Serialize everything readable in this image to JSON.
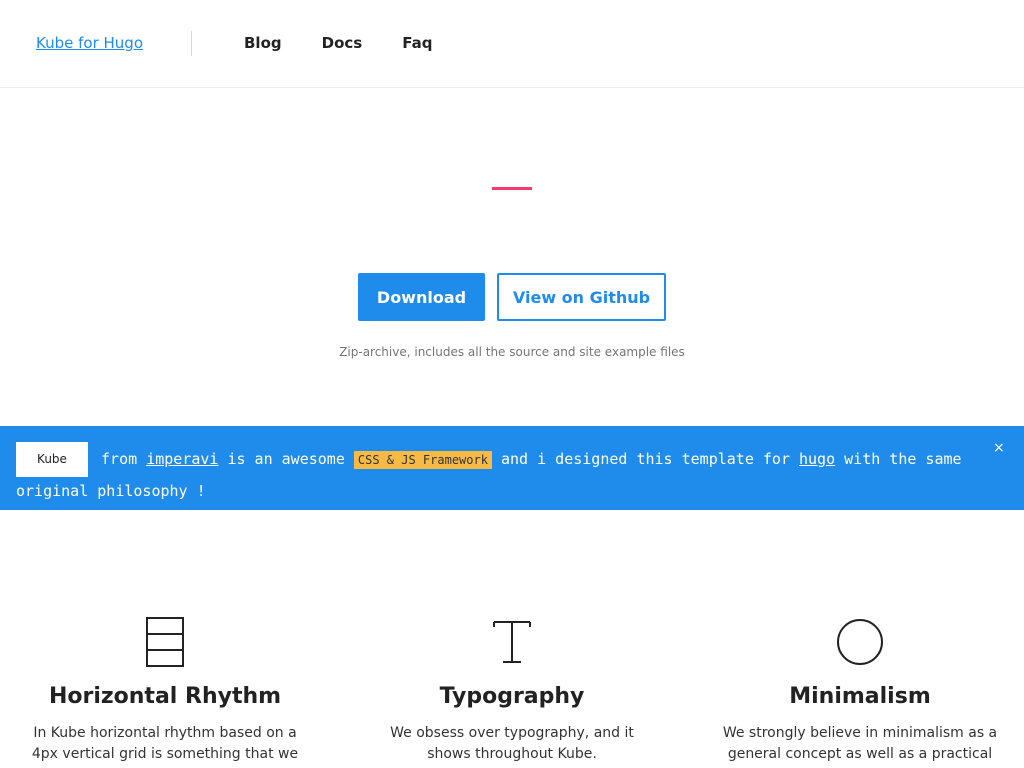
{
  "header": {
    "brand": "Kube for Hugo",
    "nav": [
      "Blog",
      "Docs",
      "Faq"
    ]
  },
  "hero": {
    "download_label": "Download",
    "github_label": "View on Github",
    "note": "Zip-archive, includes all the source and site example files"
  },
  "banner": {
    "label": "Kube",
    "text_1": " from ",
    "link_imperavi": "imperavi",
    "text_2": " is an awesome ",
    "tag": "CSS & JS Framework",
    "text_3": " and i designed this template for ",
    "link_hugo": "hugo",
    "text_4": " with the same original philosophy !",
    "close": "×"
  },
  "features": [
    {
      "icon": "rows-grid-icon",
      "title": "Horizontal Rhythm",
      "text": "In Kube horizontal rhythm based on a 4px vertical grid is something that we are truly"
    },
    {
      "icon": "type-t-icon",
      "title": "Typography",
      "text": "We obsess over typography, and it shows throughout Kube."
    },
    {
      "icon": "circle-icon",
      "title": "Minimalism",
      "text": "We strongly believe in minimalism as a general concept as well as a practical"
    }
  ],
  "colors": {
    "accent": "#1f8ceb",
    "pink": "#f03c69",
    "tag": "#f7ba45"
  }
}
